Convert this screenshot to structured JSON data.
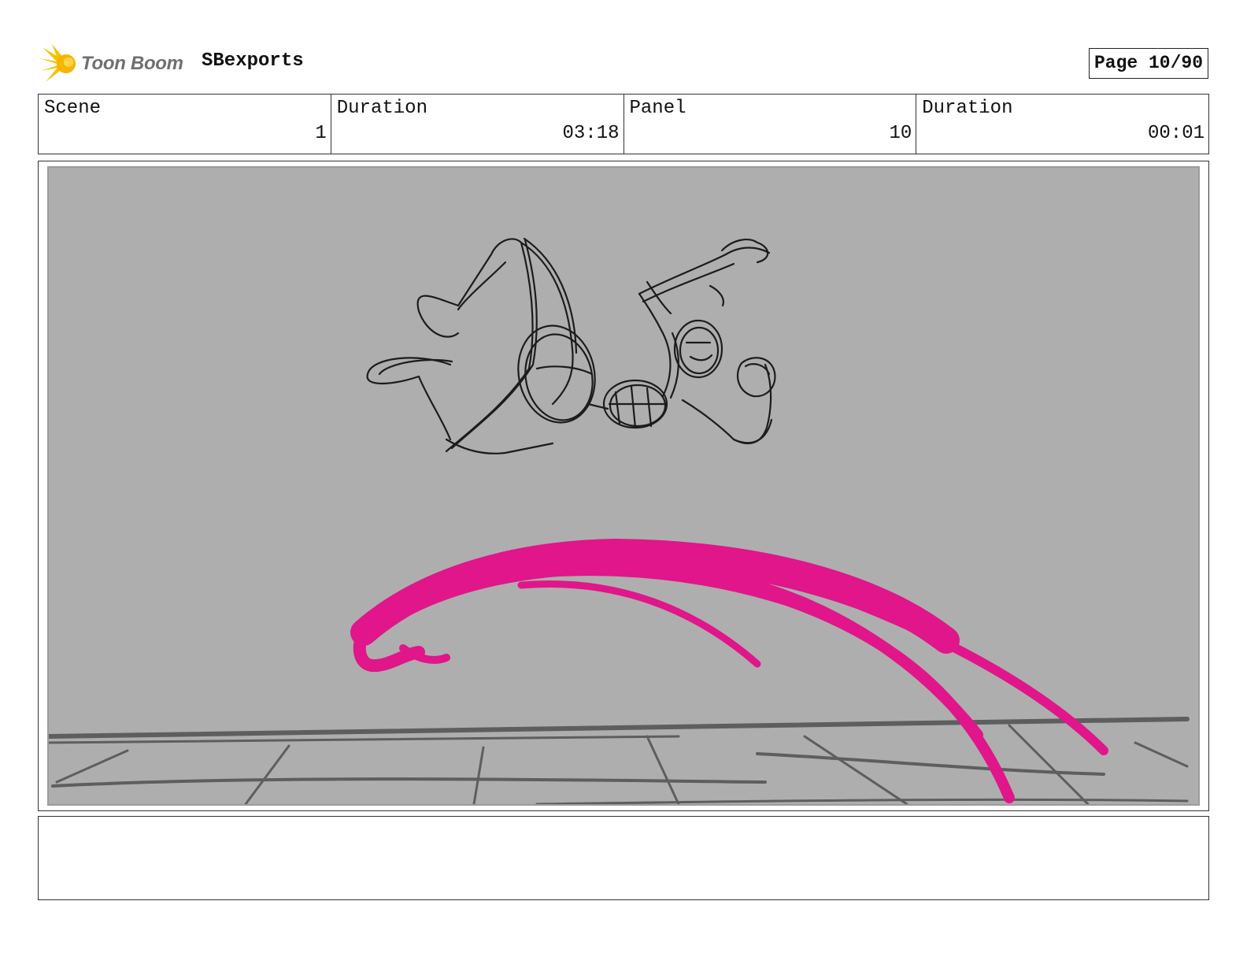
{
  "header": {
    "logo": {
      "text": "Toon Boom",
      "icon": "toon-boom-logo-icon",
      "color": "#f5c200"
    },
    "project_name": "SBexports",
    "page_label": "Page 10/90"
  },
  "info": {
    "scene": {
      "label": "Scene",
      "value": "1"
    },
    "scene_duration": {
      "label": "Duration",
      "value": "03:18"
    },
    "panel": {
      "label": "Panel",
      "value": "10"
    },
    "panel_duration": {
      "label": "Duration",
      "value": "00:01"
    }
  },
  "panel_image": {
    "background_color": "#aeaeae",
    "stroke_color": "#e0168a",
    "sketch_color": "#1c1c1c",
    "floor_color": "#5e5e5e"
  },
  "notes": {
    "text": ""
  }
}
